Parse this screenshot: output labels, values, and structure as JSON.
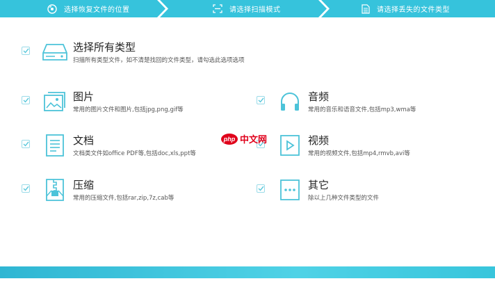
{
  "steps": [
    {
      "label": "选择恢复文件的位置",
      "icon": "disc-icon"
    },
    {
      "label": "请选择扫描模式",
      "icon": "scan-icon"
    },
    {
      "label": "请选择丢失的文件类型",
      "icon": "document-icon"
    }
  ],
  "options": {
    "all": {
      "title": "选择所有类型",
      "desc": "扫描所有类型文件，如不清楚找回的文件类型，请勾选此选项选项",
      "checked": true,
      "icon": "drive-icon"
    },
    "images": {
      "title": "图片",
      "desc": "常用的图片文件和图片,包括jpg,png,gif等",
      "checked": true,
      "icon": "image-icon"
    },
    "audio": {
      "title": "音频",
      "desc": "常用的音乐和语音文件,包括mp3,wma等",
      "checked": true,
      "icon": "headphones-icon"
    },
    "documents": {
      "title": "文档",
      "desc": "文档类文件如office PDF等,包括doc,xls,ppt等",
      "checked": true,
      "icon": "document-list-icon"
    },
    "video": {
      "title": "视频",
      "desc": "常用的视频文件,包括mp4,rmvb,avi等",
      "checked": true,
      "icon": "video-play-icon"
    },
    "archives": {
      "title": "压缩",
      "desc": "常用的压缩文件,包括rar,zip,7z,cab等",
      "checked": true,
      "icon": "archive-icon"
    },
    "other": {
      "title": "其它",
      "desc": "除以上几种文件类型的文件",
      "checked": true,
      "icon": "more-icon"
    }
  },
  "watermark": {
    "logo": "php",
    "text": "中文网"
  },
  "colors": {
    "accent": "#36c3dc",
    "icon": "#4cc3d9",
    "check": "#5bc8dc",
    "text": "#222222",
    "muted": "#555555"
  }
}
